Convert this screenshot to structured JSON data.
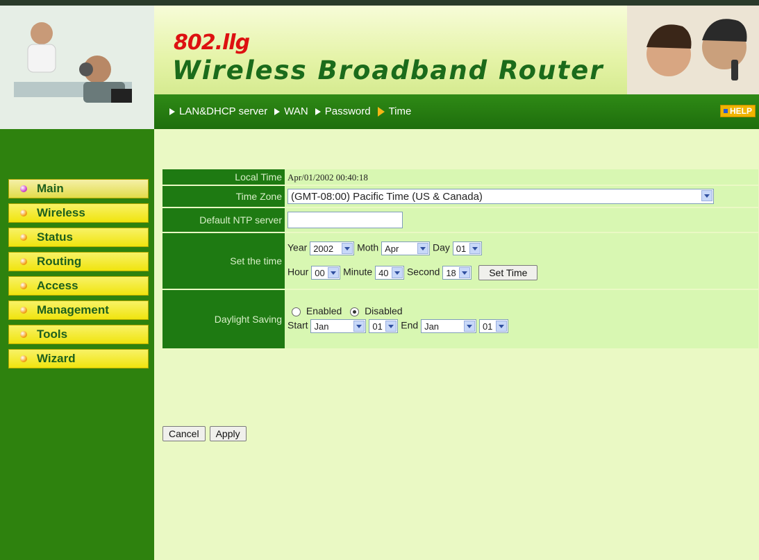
{
  "header": {
    "model": "802.llg",
    "product": "Wireless Broadband Router"
  },
  "nav": {
    "items": [
      {
        "label": "LAN&DHCP server",
        "active": false
      },
      {
        "label": "WAN",
        "active": false
      },
      {
        "label": "Password",
        "active": false
      },
      {
        "label": "Time",
        "active": true
      }
    ],
    "help_label": "HELP"
  },
  "sidebar": {
    "items": [
      {
        "label": "Main",
        "icon": "main-bullet-icon"
      },
      {
        "label": "Wireless",
        "icon": "bullet-icon"
      },
      {
        "label": "Status",
        "icon": "bullet-icon"
      },
      {
        "label": "Routing",
        "icon": "bullet-icon"
      },
      {
        "label": "Access",
        "icon": "bullet-icon"
      },
      {
        "label": "Management",
        "icon": "bullet-icon"
      },
      {
        "label": "Tools",
        "icon": "bullet-icon"
      },
      {
        "label": "Wizard",
        "icon": "bullet-icon"
      }
    ]
  },
  "form": {
    "local_time_label": "Local Time",
    "local_time_value": "Apr/01/2002 00:40:18",
    "time_zone_label": "Time Zone",
    "time_zone_value": "(GMT-08:00) Pacific Time (US & Canada)",
    "ntp_label": "Default NTP server",
    "ntp_value": "",
    "set_time_label": "Set the time",
    "year_label": "Year",
    "year_value": "2002",
    "month_label": "Moth",
    "month_value": "Apr",
    "day_label": "Day",
    "day_value": "01",
    "hour_label": "Hour",
    "hour_value": "00",
    "minute_label": "Minute",
    "minute_value": "40",
    "second_label": "Second",
    "second_value": "18",
    "set_time_button": "Set Time",
    "daylight_label": "Daylight Saving",
    "enabled_label": "Enabled",
    "disabled_label": "Disabled",
    "daylight_selected": "Disabled",
    "start_label": "Start",
    "start_month": "Jan",
    "start_day": "01",
    "end_label": "End",
    "end_month": "Jan",
    "end_day": "01"
  },
  "buttons": {
    "cancel": "Cancel",
    "apply": "Apply"
  },
  "colors": {
    "nav_green": "#2f8a16",
    "sidebar_green": "#2e820e",
    "label_green": "#1e7a12",
    "content_bg": "#eaf9c4",
    "menu_yellow": "#f0e40e",
    "brand_red": "#dd1111"
  }
}
